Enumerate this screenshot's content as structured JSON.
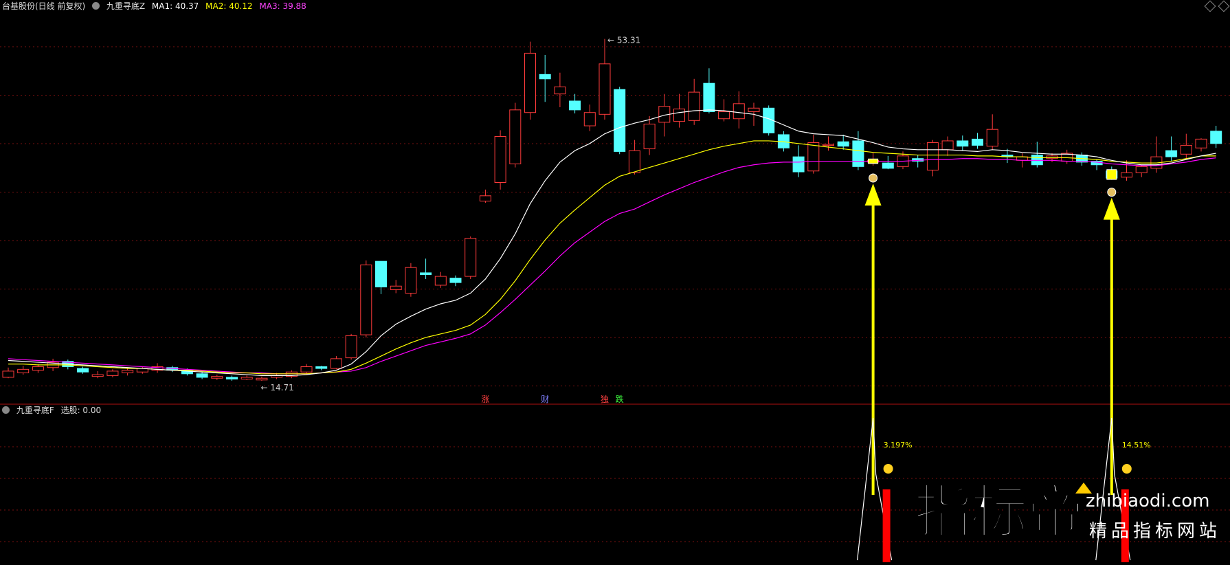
{
  "header": {
    "stock_name": "台基股份(日线 前复权)",
    "indicator_name": "九重寻底Z",
    "ma1_label": "MA1: 40.37",
    "ma2_label": "MA2: 40.12",
    "ma3_label": "MA3: 39.88"
  },
  "sub_header": {
    "indicator_name": "九重寻底F",
    "value_label": "选股: 0.00"
  },
  "colors": {
    "up": "#ff3b3b",
    "down": "#54ffff",
    "ma1": "#ffffff",
    "ma2": "#ffff00",
    "ma3": "#ff00ff",
    "grid": "#7a1010",
    "signal": "#ffff00",
    "bar": "#ff0000"
  },
  "chart_data": [
    {
      "type": "candlestick",
      "price_axis": {
        "min": 13.0,
        "max": 56.0
      },
      "high_label": "53.31",
      "low_label": "14.71",
      "candles": [
        [
          15.1,
          15.8,
          15.0,
          16.2
        ],
        [
          15.6,
          16.0,
          15.4,
          16.4
        ],
        [
          15.9,
          16.3,
          15.6,
          16.6
        ],
        [
          16.2,
          16.8,
          15.8,
          17.2
        ],
        [
          16.9,
          16.3,
          16.0,
          17.1
        ],
        [
          16.1,
          15.7,
          15.5,
          16.3
        ],
        [
          15.2,
          15.4,
          15.0,
          15.8
        ],
        [
          15.3,
          15.8,
          15.1,
          16.0
        ],
        [
          15.6,
          15.9,
          15.3,
          16.2
        ],
        [
          15.7,
          16.1,
          15.5,
          16.3
        ],
        [
          15.9,
          16.3,
          15.6,
          16.7
        ],
        [
          16.2,
          15.9,
          15.7,
          16.4
        ],
        [
          15.9,
          15.5,
          15.3,
          16.1
        ],
        [
          15.5,
          15.1,
          14.9,
          15.7
        ],
        [
          15.0,
          15.2,
          14.8,
          15.4
        ],
        [
          15.1,
          14.9,
          14.71,
          15.3
        ],
        [
          14.9,
          15.1,
          14.8,
          15.3
        ],
        [
          14.8,
          15.0,
          14.71,
          15.2
        ],
        [
          15.1,
          15.3,
          14.9,
          15.6
        ],
        [
          15.2,
          15.7,
          15.0,
          15.9
        ],
        [
          15.7,
          16.3,
          15.5,
          16.6
        ],
        [
          16.3,
          16.1,
          15.9,
          16.4
        ],
        [
          16.1,
          17.2,
          16.0,
          17.5
        ],
        [
          17.3,
          19.8,
          17.1,
          20.0
        ],
        [
          19.9,
          27.8,
          19.6,
          28.3
        ],
        [
          28.2,
          25.3,
          24.5,
          27.5
        ],
        [
          25.0,
          25.4,
          24.6,
          26.1
        ],
        [
          24.6,
          27.5,
          24.2,
          28.0
        ],
        [
          26.9,
          26.7,
          26.2,
          28.5
        ],
        [
          25.5,
          26.5,
          25.2,
          27.0
        ],
        [
          26.3,
          25.8,
          25.4,
          26.6
        ],
        [
          26.5,
          30.8,
          26.2,
          31.0
        ],
        [
          35.0,
          35.6,
          34.8,
          36.3
        ],
        [
          37.1,
          42.3,
          36.3,
          43.0
        ],
        [
          39.2,
          45.3,
          38.8,
          46.1
        ],
        [
          45.0,
          51.7,
          44.2,
          53.0
        ],
        [
          49.3,
          48.8,
          46.2,
          51.5
        ],
        [
          47.1,
          47.9,
          45.6,
          49.5
        ],
        [
          46.3,
          45.3,
          44.9,
          47.1
        ],
        [
          43.5,
          45.0,
          42.9,
          45.9
        ],
        [
          44.8,
          50.5,
          44.2,
          53.31
        ],
        [
          47.6,
          40.6,
          40.3,
          47.9
        ],
        [
          38.2,
          40.7,
          38.0,
          41.9
        ],
        [
          40.9,
          43.7,
          40.2,
          44.6
        ],
        [
          43.9,
          45.7,
          42.3,
          47.1
        ],
        [
          44.0,
          45.4,
          43.3,
          47.1
        ],
        [
          44.1,
          47.3,
          43.6,
          48.8
        ],
        [
          48.3,
          45.1,
          44.9,
          50.0
        ],
        [
          44.3,
          45.1,
          44.0,
          46.5
        ],
        [
          44.3,
          46.0,
          43.2,
          47.4
        ],
        [
          45.1,
          45.5,
          43.5,
          46.1
        ],
        [
          45.5,
          42.7,
          42.4,
          45.8
        ],
        [
          42.5,
          41.0,
          40.6,
          42.9
        ],
        [
          40.0,
          38.3,
          37.7,
          41.3
        ],
        [
          38.4,
          41.6,
          38.1,
          42.5
        ],
        [
          41.3,
          41.4,
          40.7,
          42.3
        ],
        [
          41.7,
          41.2,
          40.8,
          42.5
        ],
        [
          41.8,
          38.9,
          38.5,
          42.9
        ],
        [
          39.4,
          39.6,
          39.0,
          40.5
        ],
        [
          39.3,
          38.7,
          38.6,
          40.1
        ],
        [
          38.9,
          40.1,
          38.6,
          40.6
        ],
        [
          39.8,
          39.5,
          38.8,
          40.2
        ],
        [
          38.5,
          41.6,
          37.8,
          41.9
        ],
        [
          40.8,
          41.8,
          40.1,
          42.3
        ],
        [
          41.8,
          41.2,
          40.7,
          42.4
        ],
        [
          42.0,
          41.3,
          40.9,
          42.7
        ],
        [
          41.2,
          43.1,
          40.8,
          44.8
        ],
        [
          40.2,
          40.0,
          39.3,
          40.9
        ],
        [
          39.6,
          40.0,
          38.8,
          40.4
        ],
        [
          40.2,
          39.1,
          38.8,
          41.7
        ],
        [
          39.8,
          40.1,
          39.4,
          40.4
        ],
        [
          39.5,
          40.4,
          39.2,
          40.8
        ],
        [
          40.2,
          39.4,
          39.0,
          40.5
        ],
        [
          39.5,
          39.1,
          38.5,
          39.7
        ],
        [
          38.4,
          37.6,
          37.4,
          38.9
        ],
        [
          37.7,
          38.2,
          37.3,
          39.6
        ],
        [
          38.2,
          38.9,
          37.7,
          39.1
        ],
        [
          38.7,
          40.0,
          38.2,
          42.3
        ],
        [
          40.7,
          40.0,
          39.5,
          42.3
        ],
        [
          40.3,
          41.3,
          39.7,
          42.6
        ],
        [
          41.0,
          42.0,
          40.6,
          42.1
        ],
        [
          42.9,
          41.5,
          41.0,
          43.5
        ]
      ],
      "ma1": [
        17.0,
        16.9,
        16.8,
        16.7,
        16.6,
        16.5,
        16.4,
        16.3,
        16.2,
        16.1,
        16.0,
        15.9,
        15.8,
        15.7,
        15.6,
        15.5,
        15.4,
        15.3,
        15.3,
        15.3,
        15.4,
        15.6,
        15.9,
        16.6,
        18.0,
        19.8,
        21.1,
        22.0,
        22.8,
        23.4,
        23.8,
        24.6,
        26.2,
        28.5,
        31.3,
        34.7,
        37.3,
        39.4,
        40.7,
        41.5,
        42.6,
        43.3,
        43.8,
        44.2,
        44.7,
        45.0,
        45.2,
        45.3,
        45.2,
        45.0,
        44.8,
        44.3,
        43.6,
        42.9,
        42.6,
        42.5,
        42.4,
        42.0,
        41.6,
        41.1,
        40.9,
        40.8,
        40.8,
        40.8,
        40.7,
        40.6,
        40.8,
        40.7,
        40.5,
        40.4,
        40.3,
        40.3,
        40.2,
        40.0,
        39.6,
        39.3,
        39.1,
        39.1,
        39.3,
        39.7,
        40.1,
        40.4
      ],
      "ma2": [
        16.6,
        16.6,
        16.5,
        16.5,
        16.5,
        16.4,
        16.3,
        16.2,
        16.1,
        16.1,
        16.0,
        15.9,
        15.9,
        15.8,
        15.7,
        15.6,
        15.6,
        15.5,
        15.5,
        15.5,
        15.5,
        15.6,
        15.7,
        16.0,
        16.7,
        17.5,
        18.3,
        19.0,
        19.6,
        20.0,
        20.4,
        21.0,
        22.2,
        23.9,
        26.0,
        28.4,
        30.6,
        32.5,
        34.0,
        35.4,
        36.8,
        37.8,
        38.3,
        38.8,
        39.3,
        39.8,
        40.3,
        40.8,
        41.2,
        41.5,
        41.8,
        41.8,
        41.7,
        41.5,
        41.3,
        41.1,
        40.9,
        40.7,
        40.5,
        40.4,
        40.3,
        40.2,
        40.2,
        40.2,
        40.2,
        40.1,
        40.1,
        40.0,
        40.0,
        39.9,
        39.9,
        39.9,
        39.8,
        39.7,
        39.5,
        39.4,
        39.3,
        39.3,
        39.5,
        39.8,
        40.1,
        40.1
      ],
      "ma3": [
        17.2,
        17.1,
        17.0,
        16.9,
        16.8,
        16.7,
        16.6,
        16.5,
        16.4,
        16.3,
        16.2,
        16.1,
        16.0,
        15.9,
        15.8,
        15.7,
        15.6,
        15.6,
        15.5,
        15.5,
        15.5,
        15.6,
        15.7,
        15.8,
        16.2,
        16.9,
        17.5,
        18.1,
        18.7,
        19.1,
        19.5,
        20.0,
        21.0,
        22.4,
        23.9,
        25.5,
        27.1,
        28.8,
        30.3,
        31.5,
        32.7,
        33.6,
        34.1,
        34.9,
        35.7,
        36.4,
        37.1,
        37.7,
        38.3,
        38.8,
        39.1,
        39.3,
        39.4,
        39.4,
        39.5,
        39.5,
        39.5,
        39.5,
        39.5,
        39.5,
        39.5,
        39.6,
        39.7,
        39.7,
        39.8,
        39.8,
        39.7,
        39.7,
        39.6,
        39.6,
        39.6,
        39.5,
        39.5,
        39.4,
        39.2,
        39.1,
        39.0,
        39.0,
        39.2,
        39.4,
        39.7,
        39.88
      ],
      "labels": [
        {
          "text": "涨",
          "index": 32,
          "color": "#ff4040"
        },
        {
          "text": "财",
          "index": 36,
          "color": "#8080ff"
        },
        {
          "text": "独",
          "index": 40,
          "color": "#ff4040"
        },
        {
          "text": "跌",
          "index": 41,
          "color": "#40ff40"
        }
      ],
      "signals": [
        {
          "index": 58,
          "pct_label": "3.197%"
        },
        {
          "index": 74,
          "pct_label": "14.51%"
        }
      ]
    }
  ],
  "watermark": {
    "brand_cn": "指标帝",
    "brand_en": "zhibiaodi.com",
    "slogan": "精品指标网站"
  }
}
